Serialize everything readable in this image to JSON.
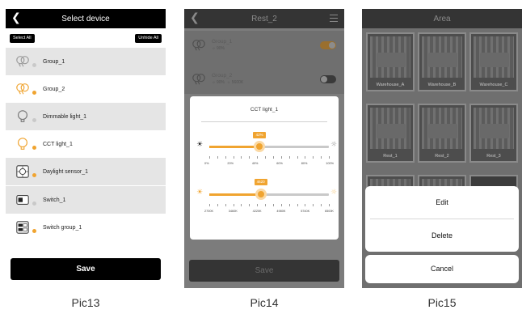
{
  "pic13": {
    "header_title": "Select device",
    "back_icon": "chevron-left-icon",
    "select_all": "Select All",
    "unhide_all": "Unhide All",
    "devices": [
      {
        "name": "Group_1",
        "icon": "group-bulbs-icon",
        "active": false
      },
      {
        "name": "Group_2",
        "icon": "group-bulbs-icon",
        "active": true
      },
      {
        "name": "Dimmable light_1",
        "icon": "bulb-icon",
        "active": false
      },
      {
        "name": "CCT light_1",
        "icon": "bulb-icon",
        "active": true
      },
      {
        "name": "Daylight sensor_1",
        "icon": "sensor-icon",
        "active": true
      },
      {
        "name": "Switch_1",
        "icon": "switch-icon",
        "active": false
      },
      {
        "name": "Switch group_1",
        "icon": "switch-group-icon",
        "active": true
      }
    ],
    "save": "Save",
    "caption": "Pic13"
  },
  "pic14": {
    "header_title": "Rest_2",
    "groups": [
      {
        "name": "Group_1",
        "brightness": "90%",
        "cct": "",
        "on": true
      },
      {
        "name": "Group_2",
        "brightness": "90%",
        "cct": "5600K",
        "on": false
      }
    ],
    "card_title": "CCT light_1",
    "brightness": {
      "value_label": "42%",
      "value": 0.42,
      "ticks": [
        "0%",
        "20%",
        "40%",
        "60%",
        "80%",
        "100%"
      ]
    },
    "cct": {
      "value_label": "4620",
      "value": 0.43,
      "ticks": [
        "2700K",
        "3460K",
        "4220K",
        "4980K",
        "5740K",
        "6500K"
      ]
    },
    "save": "Save",
    "caption": "Pic14"
  },
  "pic15": {
    "header_title": "Area",
    "tiles": [
      "Warehouse_A",
      "Warehouse_B",
      "Warehouse_C",
      "Rest_1",
      "Rest_2",
      "Rest_3"
    ],
    "actions": [
      "Edit",
      "Delete"
    ],
    "cancel": "Cancel",
    "caption": "Pic15"
  },
  "colors": {
    "accent": "#f0a430",
    "header": "#000000",
    "overlay": "#6f6f6f"
  }
}
